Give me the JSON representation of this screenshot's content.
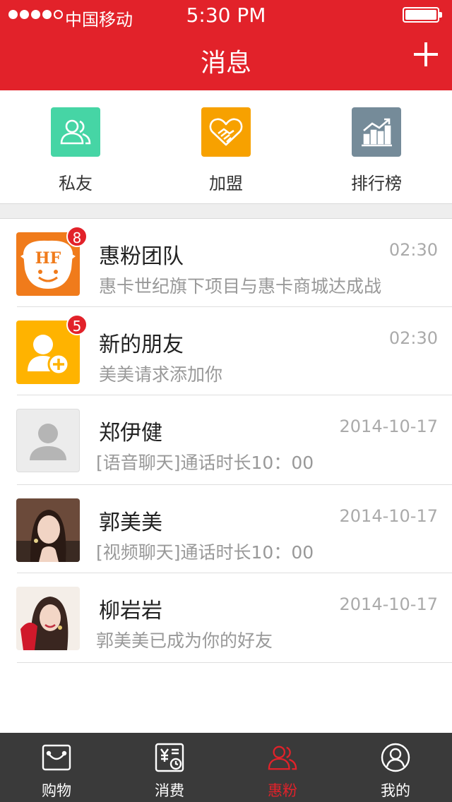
{
  "status": {
    "carrier": "中国移动",
    "time": "5:30 PM"
  },
  "header": {
    "title": "消息"
  },
  "quick": {
    "items": [
      {
        "label": "私友",
        "icon": "friends-icon",
        "color": "#46d5a5"
      },
      {
        "label": "加盟",
        "icon": "handshake-heart-icon",
        "color": "#f7a100"
      },
      {
        "label": "排行榜",
        "icon": "ranking-chart-icon",
        "color": "#758b99"
      }
    ]
  },
  "messages": [
    {
      "name": "惠粉团队",
      "time": "02:30",
      "preview": "惠卡世纪旗下项目与惠卡商城达成战",
      "badge": "8"
    },
    {
      "name": "新的朋友",
      "time": "02:30",
      "preview": "美美请求添加你",
      "badge": "5"
    },
    {
      "name": "郑伊健",
      "time": "2014-10-17",
      "preview": "[语音聊天]通话时长10：00",
      "badge": ""
    },
    {
      "name": "郭美美",
      "time": "2014-10-17",
      "preview": "[视频聊天]通话时长10：00",
      "badge": ""
    },
    {
      "name": "柳岩岩",
      "time": "2014-10-17",
      "preview": "郭美美已成为你的好友",
      "badge": ""
    }
  ],
  "logo_text": "HF",
  "tabs": [
    {
      "label": "购物",
      "icon": "shopping-bag-icon"
    },
    {
      "label": "消费",
      "icon": "receipt-icon"
    },
    {
      "label": "惠粉",
      "icon": "fans-icon",
      "active": true
    },
    {
      "label": "我的",
      "icon": "profile-icon"
    }
  ],
  "colors": {
    "brand": "#e2222a",
    "tabbar": "#3a3a3a"
  }
}
